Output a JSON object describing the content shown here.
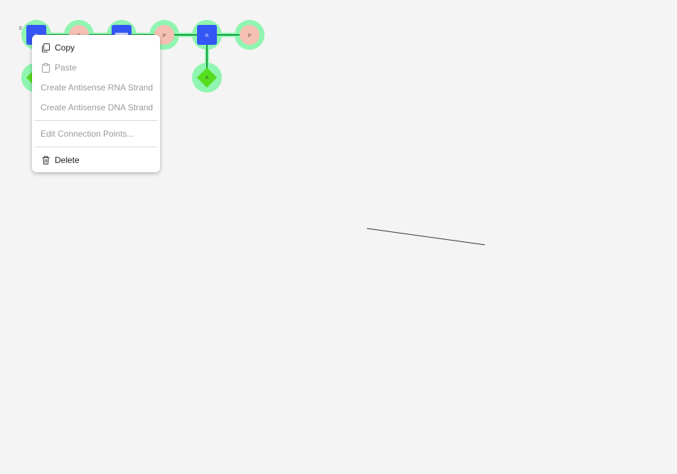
{
  "colors": {
    "background": "#f4f4f4",
    "selection_halo": "#8ff5b0",
    "sugar": "#3456f5",
    "phosphate": "#f5c0b3",
    "base": "#55dd1e",
    "bond": "#0f9a3a"
  },
  "canvas": {
    "terminal_label": "5'",
    "monomers": [
      {
        "kind": "sugar",
        "label": "R"
      },
      {
        "kind": "phosphate",
        "label": "P"
      },
      {
        "kind": "sugar",
        "label": "R"
      },
      {
        "kind": "phosphate",
        "label": "P"
      },
      {
        "kind": "sugar",
        "label": "R"
      },
      {
        "kind": "phosphate",
        "label": "P"
      },
      {
        "kind": "base",
        "label": "A"
      },
      {
        "kind": "base",
        "label": "A"
      }
    ]
  },
  "context_menu": {
    "copy": {
      "label": "Copy",
      "icon": "copy-icon"
    },
    "paste": {
      "label": "Paste",
      "icon": "paste-icon"
    },
    "antisense_rna": {
      "label": "Create Antisense RNA Strand"
    },
    "antisense_dna": {
      "label": "Create Antisense DNA Strand"
    },
    "edit_connection_points": {
      "label": "Edit Connection Points..."
    },
    "delete": {
      "label": "Delete",
      "icon": "trash-icon"
    }
  }
}
